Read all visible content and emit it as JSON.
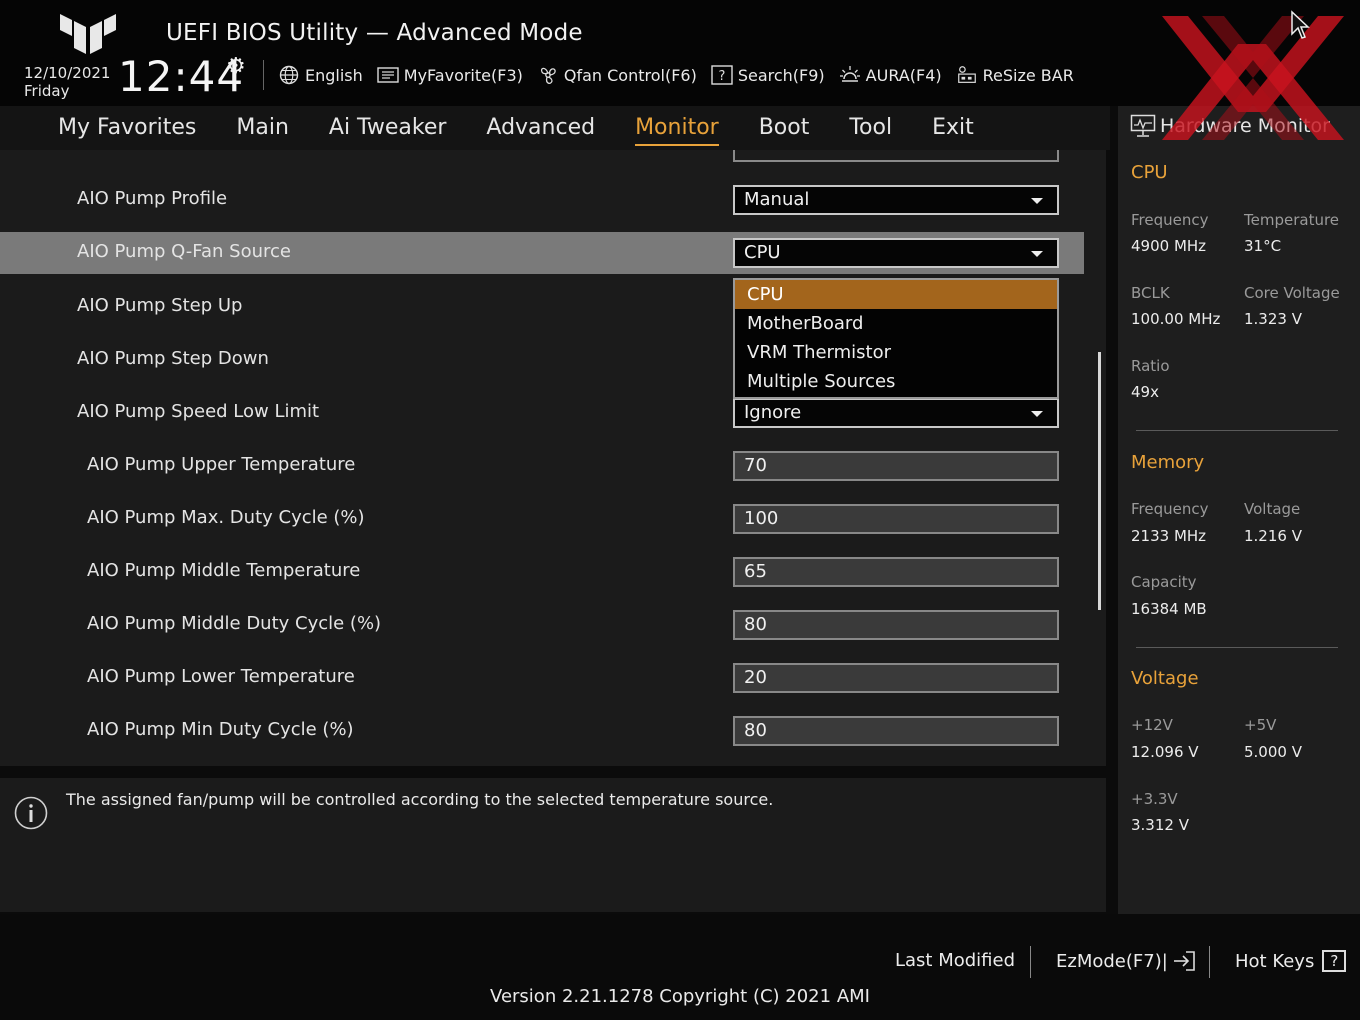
{
  "header": {
    "title": "UEFI BIOS Utility — Advanced Mode",
    "date": "12/10/2021",
    "day": "Friday",
    "time": "12:44",
    "toolbar": [
      {
        "label": "English",
        "icon": "globe-icon"
      },
      {
        "label": "MyFavorite(F3)",
        "icon": "favorite-list-icon"
      },
      {
        "label": "Qfan Control(F6)",
        "icon": "fan-icon"
      },
      {
        "label": "Search(F9)",
        "icon": "question-icon"
      },
      {
        "label": "AURA(F4)",
        "icon": "aura-light-icon"
      },
      {
        "label": "ReSize BAR",
        "icon": "resize-bar-icon"
      }
    ]
  },
  "nav": {
    "tabs": [
      "My Favorites",
      "Main",
      "Ai Tweaker",
      "Advanced",
      "Monitor",
      "Boot",
      "Tool",
      "Exit"
    ],
    "active": "Monitor"
  },
  "settings": {
    "rows": [
      {
        "label": "AIO Pump Profile",
        "control": "select",
        "value": "Manual"
      },
      {
        "label": "AIO Pump Q-Fan Source",
        "control": "select",
        "value": "CPU",
        "highlight": true
      },
      {
        "label": "AIO Pump Step Up"
      },
      {
        "label": "AIO Pump Step Down"
      },
      {
        "label": "AIO Pump Speed Low Limit",
        "control": "select",
        "value": "Ignore"
      },
      {
        "label": "AIO Pump Upper Temperature",
        "control": "value",
        "value": "70"
      },
      {
        "label": "AIO Pump Max. Duty Cycle (%)",
        "control": "value",
        "value": "100"
      },
      {
        "label": "AIO Pump Middle Temperature",
        "control": "value",
        "value": "65"
      },
      {
        "label": "AIO Pump Middle Duty Cycle (%)",
        "control": "value",
        "value": "80"
      },
      {
        "label": "AIO Pump Lower Temperature",
        "control": "value",
        "value": "20"
      },
      {
        "label": "AIO Pump Min Duty Cycle (%)",
        "control": "value",
        "value": "80"
      }
    ],
    "dropdown": {
      "options": [
        "CPU",
        "MotherBoard",
        "VRM Thermistor",
        "Multiple Sources"
      ],
      "selected": "CPU"
    }
  },
  "info": {
    "text": "The assigned fan/pump will be controlled according to the selected temperature source."
  },
  "hw": {
    "title": "Hardware Monitor",
    "cpu": {
      "heading": "CPU",
      "freq_label": "Frequency",
      "freq": "4900 MHz",
      "temp_label": "Temperature",
      "temp": "31°C",
      "bclk_label": "BCLK",
      "bclk": "100.00 MHz",
      "cv_label": "Core Voltage",
      "cv": "1.323 V",
      "ratio_label": "Ratio",
      "ratio": "49x"
    },
    "memory": {
      "heading": "Memory",
      "freq_label": "Frequency",
      "freq": "2133 MHz",
      "volt_label": "Voltage",
      "volt": "1.216 V",
      "cap_label": "Capacity",
      "cap": "16384 MB"
    },
    "voltage": {
      "heading": "Voltage",
      "v12_label": "+12V",
      "v12": "12.096 V",
      "v5_label": "+5V",
      "v5": "5.000 V",
      "v33_label": "+3.3V",
      "v33": "3.312 V"
    }
  },
  "footer": {
    "last_modified": "Last Modified",
    "ezmode": "EzMode(F7)|",
    "hotkeys": "Hot Keys",
    "hotkeys_glyph": "?",
    "version": "Version 2.21.1278 Copyright (C) 2021 AMI"
  },
  "colors": {
    "accent": "#e8a23a",
    "dropdown_selected": "#a3651c",
    "highlight_row": "#7a7a7a",
    "watermark": "#c8141e"
  }
}
